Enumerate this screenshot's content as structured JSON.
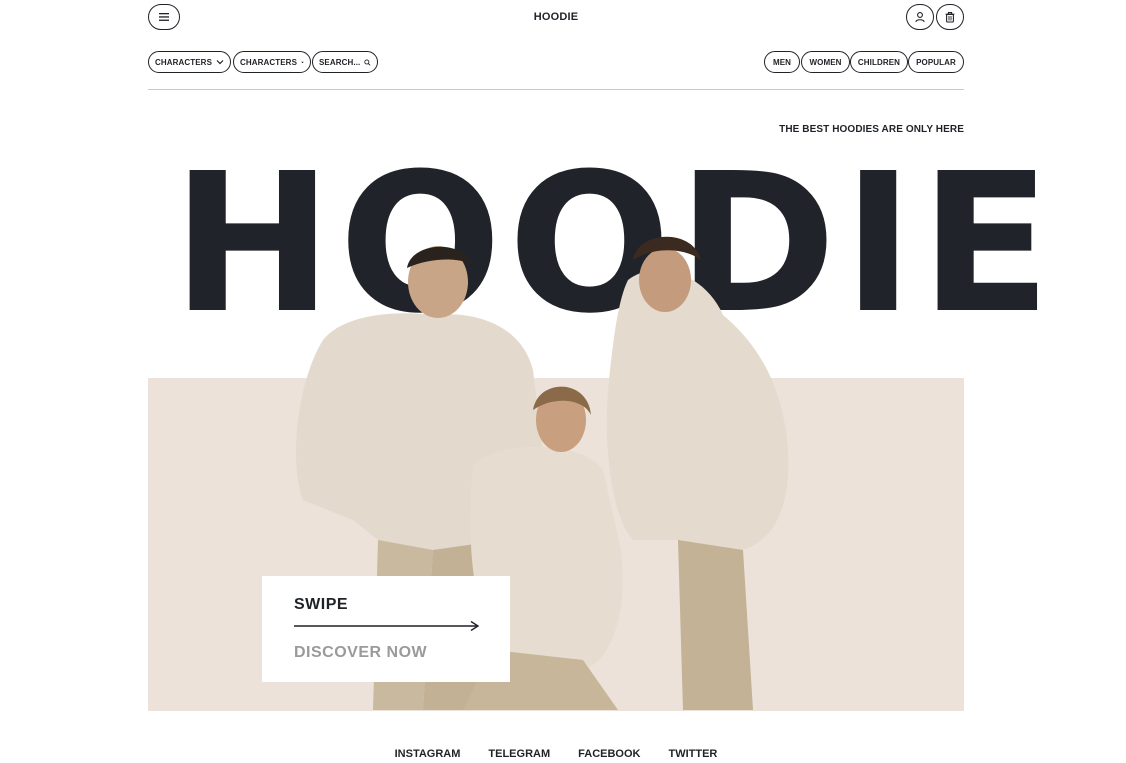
{
  "header": {
    "logo": "HOODIE",
    "icons": {
      "menu": "hamburger-menu-icon",
      "user": "user-icon",
      "cart": "trash-bag-icon"
    }
  },
  "filters": {
    "characters_1": "CHARACTERS",
    "characters_2": "CHARACTERS",
    "search_placeholder": "SEARCH...",
    "categories": [
      "MEN",
      "WOMEN",
      "CHILDREN",
      "POPULAR"
    ]
  },
  "hero": {
    "tagline": "THE BEST HOODIES ARE ONLY HERE",
    "headline": "HOODIE",
    "cta_swipe": "SWIPE",
    "cta_discover": "DISCOVER NOW"
  },
  "footer": {
    "links": [
      "INSTAGRAM",
      "TELEGRAM",
      "FACEBOOK",
      "TWITTER"
    ]
  },
  "colors": {
    "text": "#1f2227",
    "hero_band": "#ece2da",
    "hoodie_fabric": "#e6ddd0",
    "muted": "#9a9a9a"
  }
}
